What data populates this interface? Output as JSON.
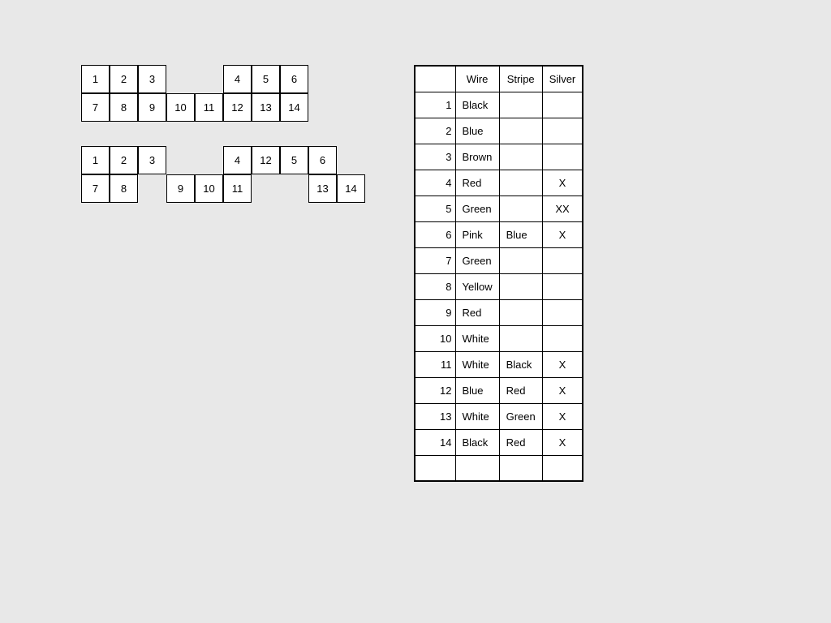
{
  "connectors": [
    {
      "id": "connector1",
      "rows": [
        [
          {
            "label": "1",
            "show": true
          },
          {
            "label": "2",
            "show": true
          },
          {
            "label": "3",
            "show": true
          },
          {
            "label": "",
            "show": false
          },
          {
            "label": "",
            "show": false
          },
          {
            "label": "4",
            "show": true
          },
          {
            "label": "5",
            "show": true
          },
          {
            "label": "6",
            "show": true
          }
        ],
        [
          {
            "label": "7",
            "show": true
          },
          {
            "label": "8",
            "show": true
          },
          {
            "label": "9",
            "show": true
          },
          {
            "label": "10",
            "show": true
          },
          {
            "label": "11",
            "show": true
          },
          {
            "label": "12",
            "show": true
          },
          {
            "label": "13",
            "show": true
          },
          {
            "label": "14",
            "show": true
          }
        ]
      ]
    },
    {
      "id": "connector2",
      "rows": [
        [
          {
            "label": "1",
            "show": true
          },
          {
            "label": "2",
            "show": true
          },
          {
            "label": "3",
            "show": true
          },
          {
            "label": "",
            "show": false
          },
          {
            "label": "",
            "show": false
          },
          {
            "label": "4",
            "show": true
          },
          {
            "label": "12",
            "show": true
          },
          {
            "label": "5",
            "show": true
          },
          {
            "label": "6",
            "show": true
          }
        ],
        [
          {
            "label": "7",
            "show": true
          },
          {
            "label": "8",
            "show": true
          },
          {
            "label": "",
            "show": false
          },
          {
            "label": "9",
            "show": true
          },
          {
            "label": "10",
            "show": true
          },
          {
            "label": "11",
            "show": true
          },
          {
            "label": "",
            "show": false
          },
          {
            "label": "",
            "show": false
          },
          {
            "label": "13",
            "show": true
          },
          {
            "label": "14",
            "show": true
          }
        ]
      ]
    }
  ],
  "table": {
    "headers": [
      "",
      "Wire",
      "Stripe",
      "Silver"
    ],
    "rows": [
      {
        "num": "1",
        "wire": "Black",
        "stripe": "",
        "silver": ""
      },
      {
        "num": "2",
        "wire": "Blue",
        "stripe": "",
        "silver": ""
      },
      {
        "num": "3",
        "wire": "Brown",
        "stripe": "",
        "silver": ""
      },
      {
        "num": "4",
        "wire": "Red",
        "stripe": "",
        "silver": "X"
      },
      {
        "num": "5",
        "wire": "Green",
        "stripe": "",
        "silver": "XX"
      },
      {
        "num": "6",
        "wire": "Pink",
        "stripe": "Blue",
        "silver": "X"
      },
      {
        "num": "7",
        "wire": "Green",
        "stripe": "",
        "silver": ""
      },
      {
        "num": "8",
        "wire": "Yellow",
        "stripe": "",
        "silver": ""
      },
      {
        "num": "9",
        "wire": "Red",
        "stripe": "",
        "silver": ""
      },
      {
        "num": "10",
        "wire": "White",
        "stripe": "",
        "silver": ""
      },
      {
        "num": "11",
        "wire": "White",
        "stripe": "Black",
        "silver": "X"
      },
      {
        "num": "12",
        "wire": "Blue",
        "stripe": "Red",
        "silver": "X"
      },
      {
        "num": "13",
        "wire": "White",
        "stripe": "Green",
        "silver": "X"
      },
      {
        "num": "14",
        "wire": "Black",
        "stripe": "Red",
        "silver": "X"
      },
      {
        "num": "",
        "wire": "",
        "stripe": "",
        "silver": ""
      }
    ]
  }
}
